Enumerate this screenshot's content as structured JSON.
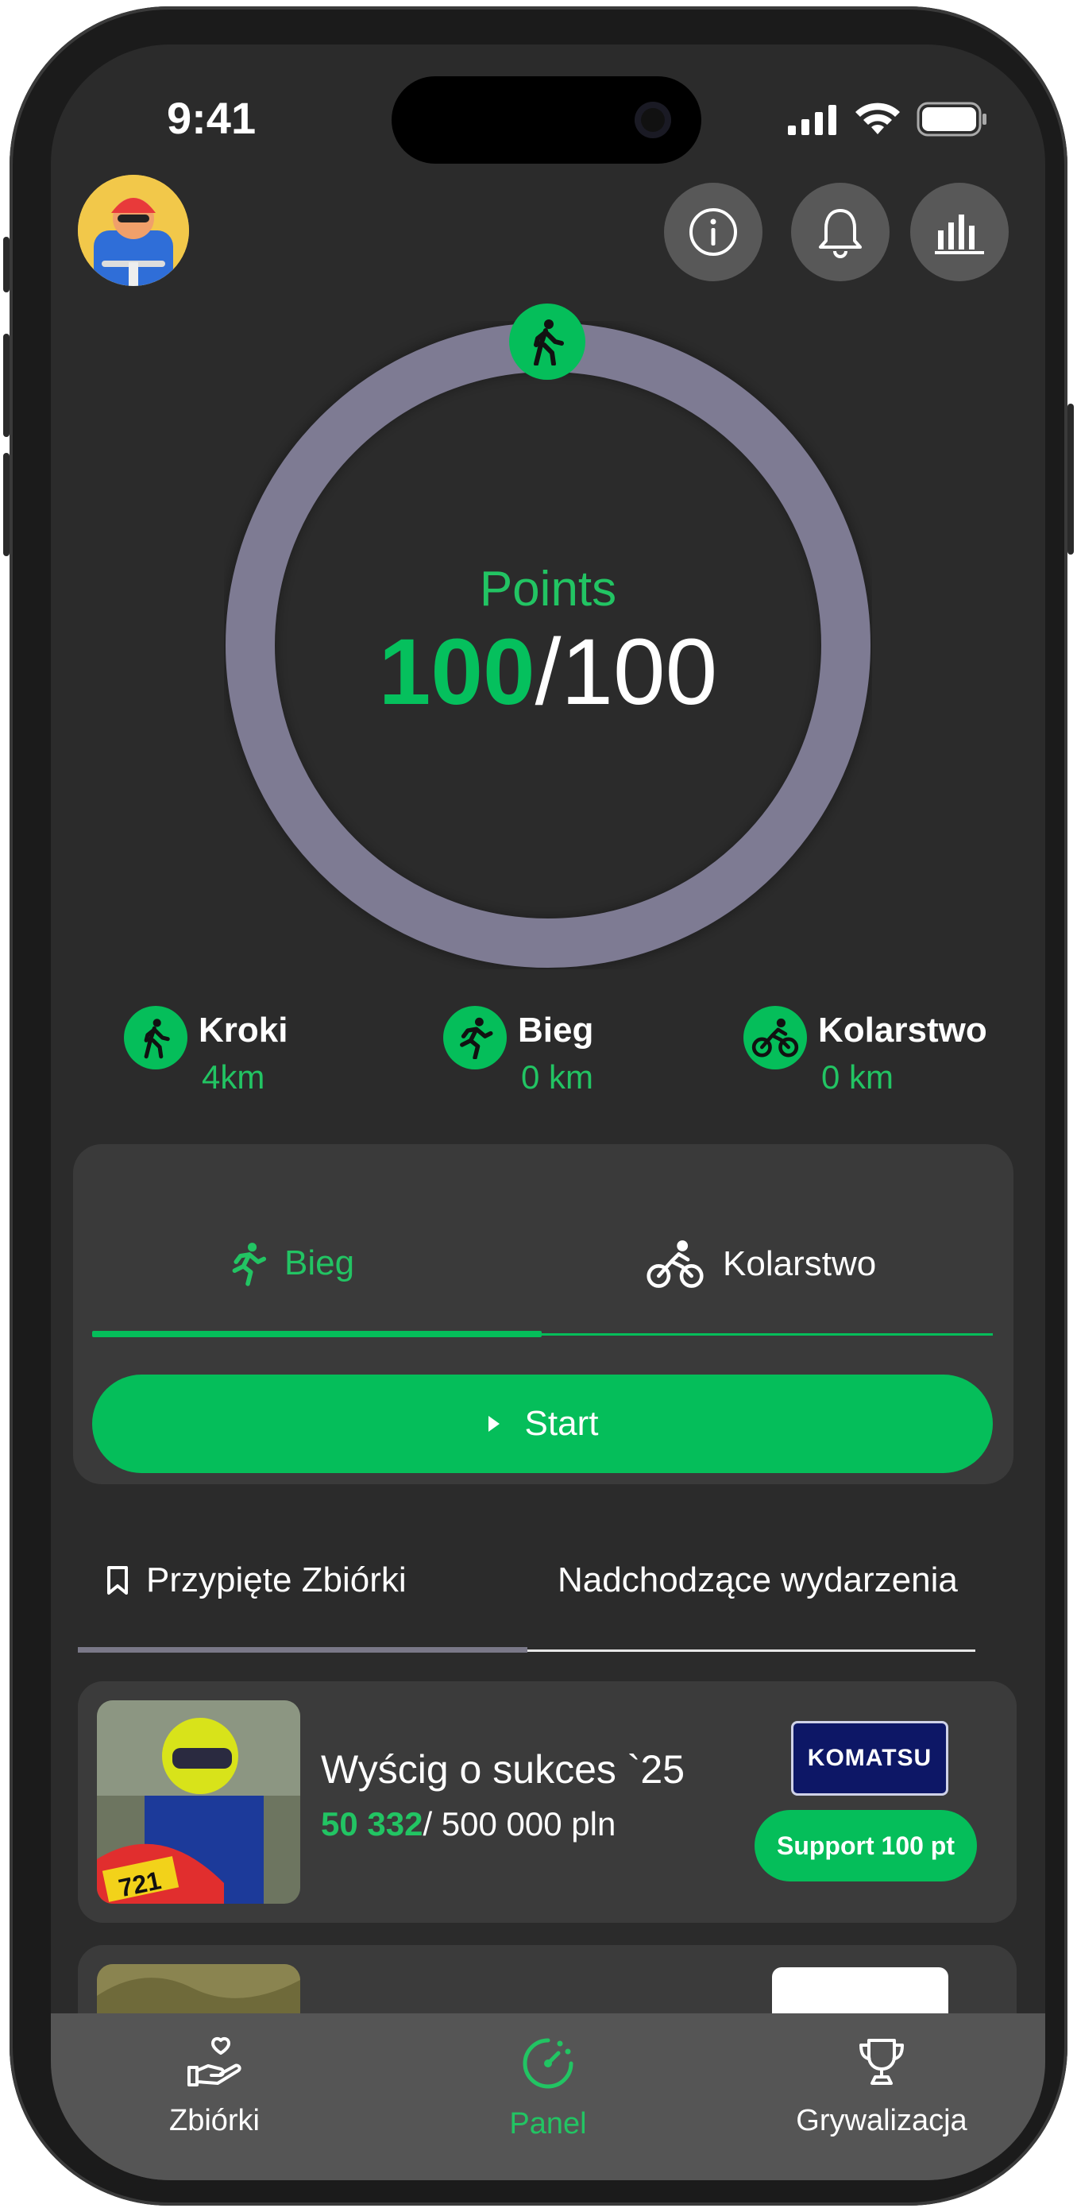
{
  "status_bar": {
    "time": "9:41"
  },
  "progress": {
    "label": "Points",
    "current": "100",
    "total": "/100",
    "fraction": 1.0
  },
  "stats": [
    {
      "name": "Kroki",
      "value": "4km",
      "icon": "walking-icon"
    },
    {
      "name": "Bieg",
      "value": "0 km",
      "icon": "running-icon"
    },
    {
      "name": "Kolarstwo",
      "value": "0 km",
      "icon": "cycling-icon"
    }
  ],
  "activity_card": {
    "tabs": [
      {
        "label": "Bieg",
        "icon": "running-icon",
        "active": true
      },
      {
        "label": "Kolarstwo",
        "icon": "cycling-icon",
        "active": false
      }
    ],
    "start_label": "Start"
  },
  "lower_tabs": [
    {
      "label": "Przypięte Zbiórki",
      "icon": "bookmark-icon",
      "active": true
    },
    {
      "label": "Nadchodzące wydarzenia",
      "active": false
    }
  ],
  "fundraisers": [
    {
      "title": "Wyścig o sukces `25",
      "raised": "50 332",
      "goal": "/ 500 000 pln",
      "sponsor": "KOMATSU",
      "support_label": "Support 100 pt"
    }
  ],
  "bottom_nav": [
    {
      "label": "Zbiórki",
      "icon": "donation-hand-icon",
      "active": false
    },
    {
      "label": "Panel",
      "icon": "dashboard-icon",
      "active": true
    },
    {
      "label": "Grywalizacja",
      "icon": "trophy-icon",
      "active": false
    }
  ],
  "colors": {
    "accent": "#05be5a",
    "ring": "#7e7b93",
    "background": "#2b2b2b",
    "card": "#3a3a3a"
  }
}
